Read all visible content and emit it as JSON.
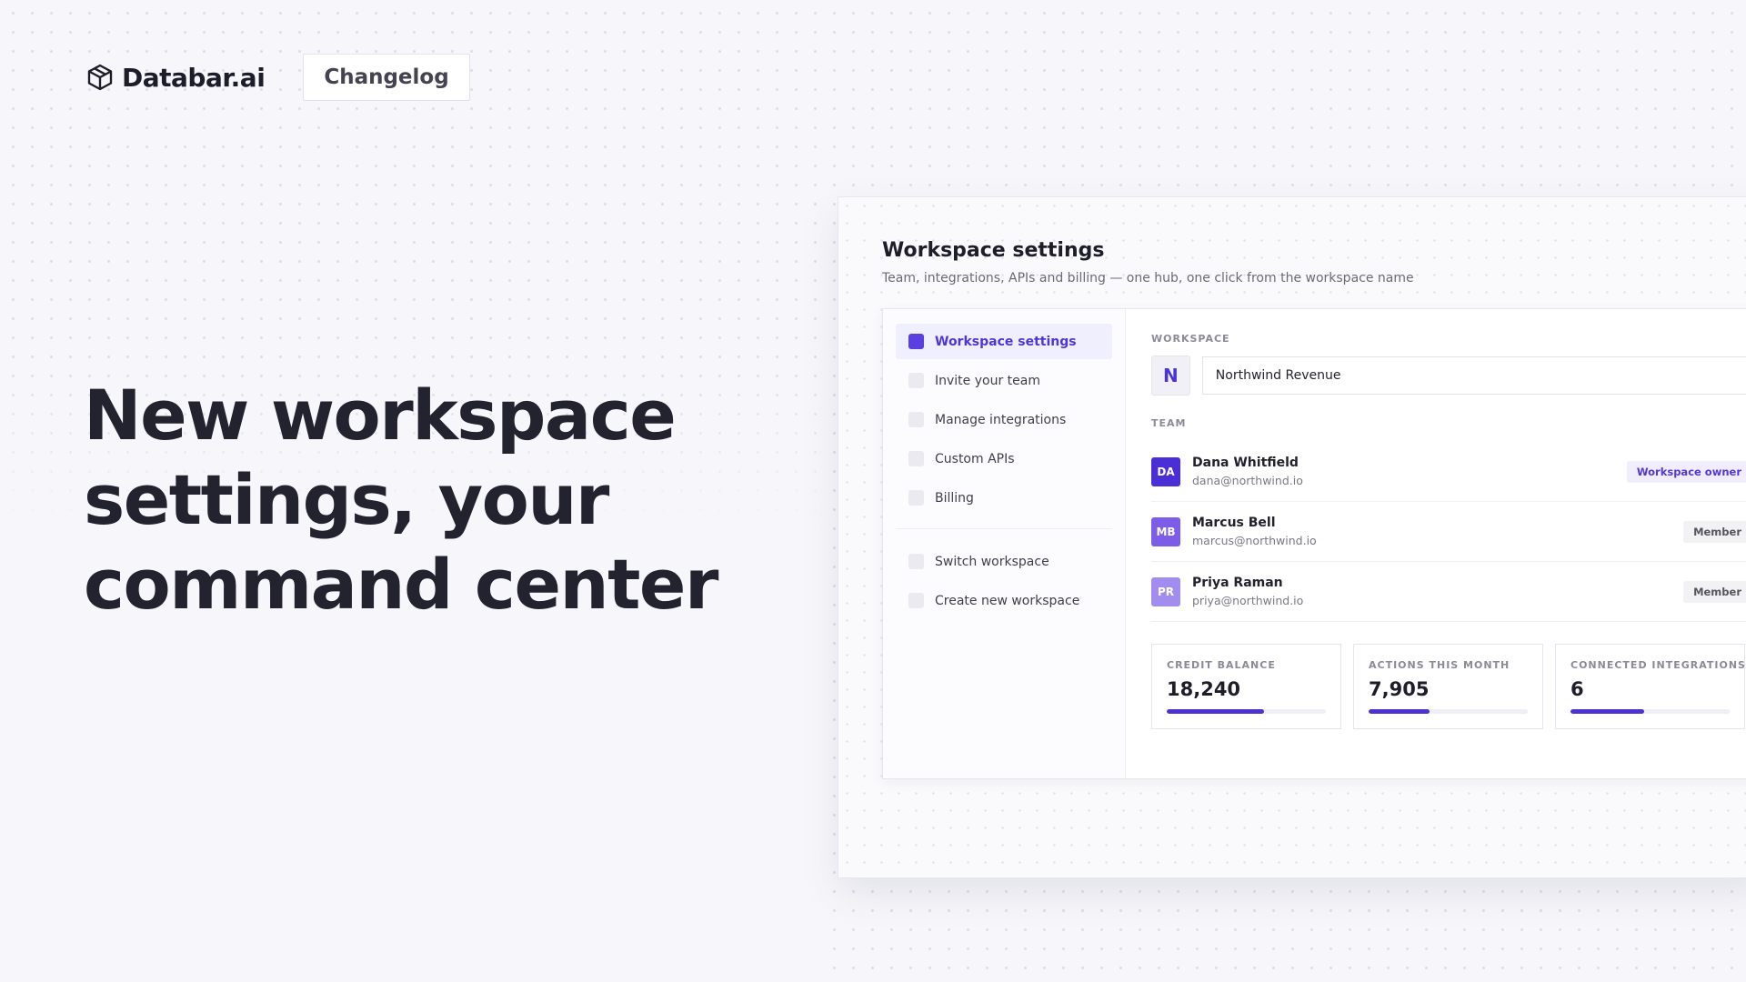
{
  "brand": {
    "name": "Databar.ai",
    "icon": "cube-icon"
  },
  "header": {
    "changelog_label": "Changelog"
  },
  "hero": {
    "lines": [
      "New workspace",
      "settings, your",
      "command center"
    ]
  },
  "screenshot": {
    "title": "Workspace settings",
    "subtitle": "Team, integrations, APIs and billing — one hub, one click from the workspace name",
    "nav": {
      "items": [
        {
          "label": "Workspace settings",
          "active": true
        },
        {
          "label": "Invite your team",
          "active": false
        },
        {
          "label": "Manage integrations",
          "active": false
        },
        {
          "label": "Custom APIs",
          "active": false
        },
        {
          "label": "Billing",
          "active": false
        }
      ],
      "secondary": [
        {
          "label": "Switch workspace"
        },
        {
          "label": "Create new workspace"
        }
      ]
    },
    "workspace": {
      "section_label": "WORKSPACE",
      "badge": "N",
      "name_value": "Northwind Revenue"
    },
    "team": {
      "section_label": "TEAM",
      "members": [
        {
          "initials": "DA",
          "name": "Dana Whitfield",
          "email": "dana@northwind.io",
          "role": "Workspace owner",
          "avatar_color": "#4b2fd6"
        },
        {
          "initials": "MB",
          "name": "Marcus Bell",
          "email": "marcus@northwind.io",
          "role": "Member",
          "avatar_color": "#7d5ce8"
        },
        {
          "initials": "PR",
          "name": "Priya Raman",
          "email": "priya@northwind.io",
          "role": "Member",
          "avatar_color": "#a28cf0"
        }
      ]
    },
    "stats": [
      {
        "label": "CREDIT BALANCE",
        "value": "18,240",
        "progress": 0.61
      },
      {
        "label": "ACTIONS THIS MONTH",
        "value": "7,905",
        "progress": 0.38
      },
      {
        "label": "CONNECTED INTEGRATIONS",
        "value": "6",
        "progress": 0.46
      }
    ]
  },
  "colors": {
    "accent": "#4b33d0",
    "background": "#f7f7fb",
    "text": "#23222f"
  }
}
